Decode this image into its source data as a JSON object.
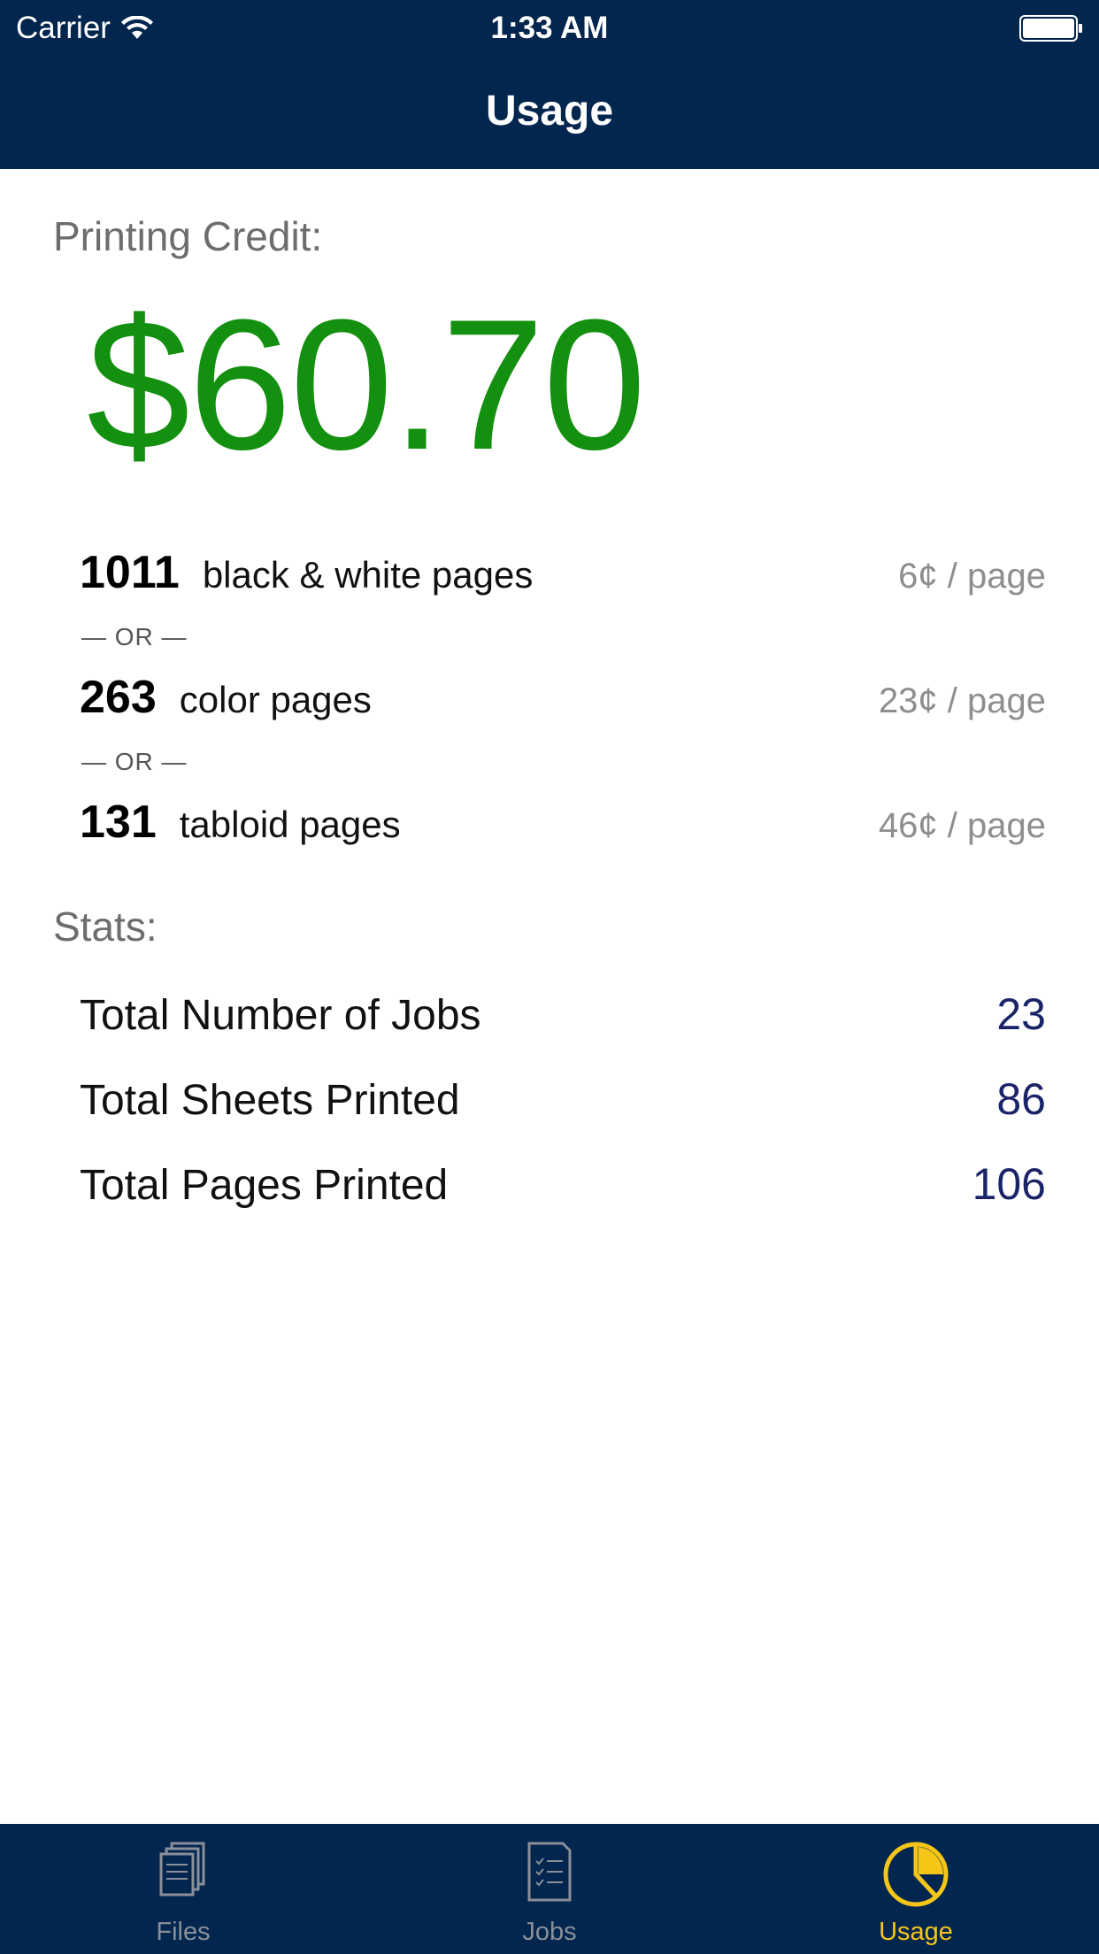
{
  "status_bar": {
    "carrier": "Carrier",
    "time": "1:33 AM"
  },
  "nav": {
    "title": "Usage"
  },
  "credit": {
    "label": "Printing Credit:",
    "amount": "$60.70",
    "amount_color": "#13900f",
    "options": [
      {
        "count": "1011",
        "description": "black & white pages",
        "rate": "6¢ / page"
      },
      {
        "count": "263",
        "description": "color pages",
        "rate": "23¢ / page"
      },
      {
        "count": "131",
        "description": "tabloid pages",
        "rate": "46¢ / page"
      }
    ],
    "separator": "— OR —"
  },
  "stats": {
    "label": "Stats:",
    "rows": [
      {
        "label": "Total Number of Jobs",
        "value": "23"
      },
      {
        "label": "Total Sheets Printed",
        "value": "86"
      },
      {
        "label": "Total Pages Printed",
        "value": "106"
      }
    ]
  },
  "tabbar": {
    "tabs": [
      {
        "label": "Files",
        "icon": "files-icon",
        "active": false
      },
      {
        "label": "Jobs",
        "icon": "jobs-icon",
        "active": false
      },
      {
        "label": "Usage",
        "icon": "usage-icon",
        "active": true
      }
    ],
    "active_color": "#f5c518",
    "bar_color": "#03264f"
  }
}
